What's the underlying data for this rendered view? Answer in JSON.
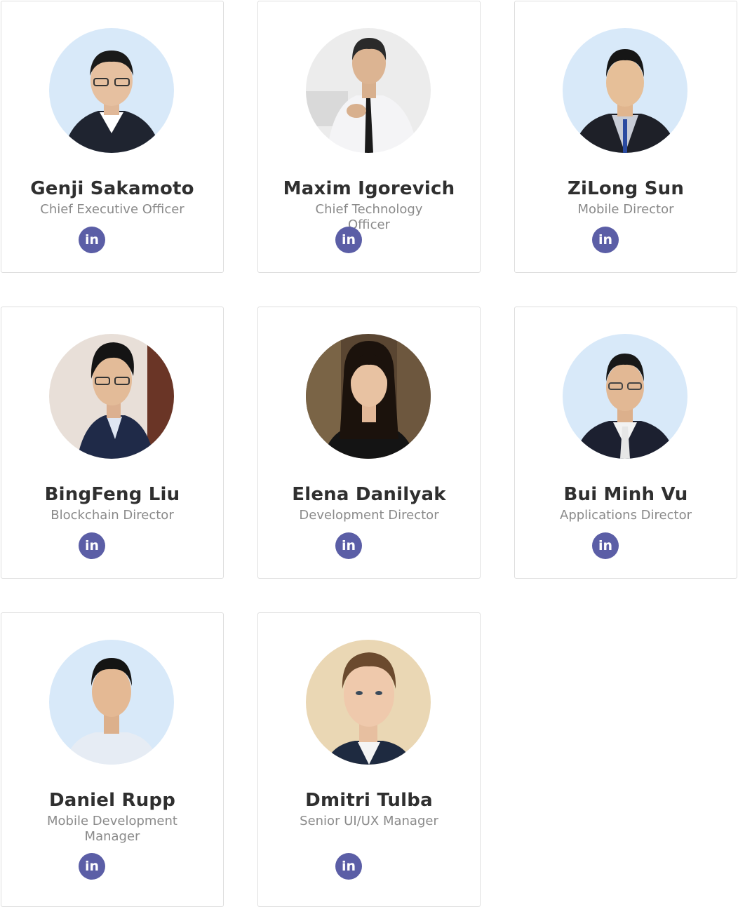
{
  "team": [
    {
      "name": "Genji Sakamoto",
      "role": "Chief Executive Officer",
      "linkedin_label": "in"
    },
    {
      "name": "Maxim Igorevich",
      "role": "Chief Technology Officer",
      "linkedin_label": "in"
    },
    {
      "name": "ZiLong Sun",
      "role": "Mobile Director",
      "linkedin_label": "in"
    },
    {
      "name": "BingFeng Liu",
      "role": "Blockchain Director",
      "linkedin_label": "in"
    },
    {
      "name": "Elena Danilyak",
      "role": "Development Director",
      "linkedin_label": "in"
    },
    {
      "name": "Bui Minh Vu",
      "role": "Applications Director",
      "linkedin_label": "in"
    },
    {
      "name": "Daniel Rupp",
      "role": "Mobile Development Manager",
      "linkedin_label": "in"
    },
    {
      "name": "Dmitri Tulba",
      "role": "Senior UI/UX Manager",
      "linkedin_label": "in"
    }
  ],
  "colors": {
    "linkedin_button": "#5b5ea6",
    "name_text": "#2f2f2f",
    "role_text": "#8a8a8a",
    "card_border": "#dedede",
    "avatar_bg_blue": "#d8e9f9"
  },
  "icons": {
    "linkedin": "linkedin-icon"
  }
}
